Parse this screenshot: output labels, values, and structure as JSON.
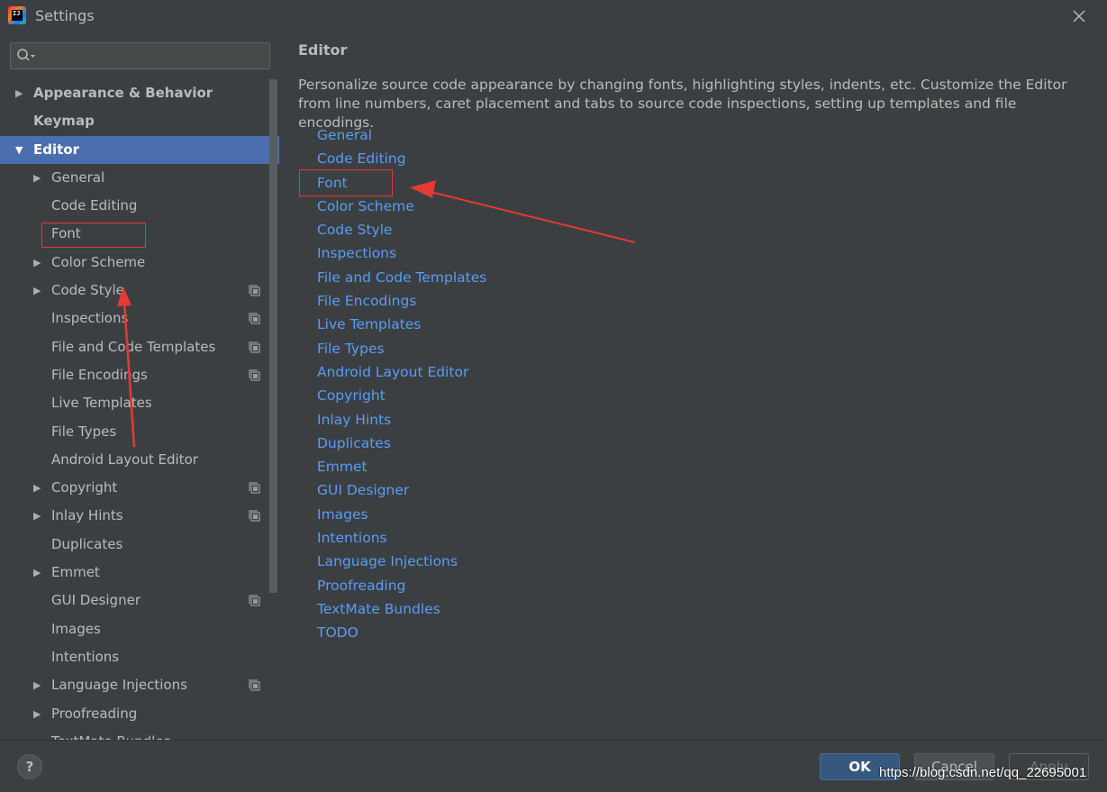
{
  "window": {
    "title": "Settings",
    "app_icon_text": "IJ"
  },
  "search": {
    "placeholder": "",
    "value": ""
  },
  "tree": [
    {
      "label": "Appearance & Behavior",
      "level": 0,
      "arrow": "▶",
      "selected": false,
      "project_icon": false
    },
    {
      "label": "Keymap",
      "level": 0,
      "arrow": "",
      "selected": false,
      "project_icon": false
    },
    {
      "label": "Editor",
      "level": 0,
      "arrow": "▼",
      "selected": true,
      "project_icon": false
    },
    {
      "label": "General",
      "level": 1,
      "arrow": "▶",
      "selected": false,
      "project_icon": false
    },
    {
      "label": "Code Editing",
      "level": 1,
      "arrow": "",
      "selected": false,
      "project_icon": false
    },
    {
      "label": "Font",
      "level": 1,
      "arrow": "",
      "selected": false,
      "project_icon": false
    },
    {
      "label": "Color Scheme",
      "level": 1,
      "arrow": "▶",
      "selected": false,
      "project_icon": false
    },
    {
      "label": "Code Style",
      "level": 1,
      "arrow": "▶",
      "selected": false,
      "project_icon": true
    },
    {
      "label": "Inspections",
      "level": 1,
      "arrow": "",
      "selected": false,
      "project_icon": true
    },
    {
      "label": "File and Code Templates",
      "level": 1,
      "arrow": "",
      "selected": false,
      "project_icon": true
    },
    {
      "label": "File Encodings",
      "level": 1,
      "arrow": "",
      "selected": false,
      "project_icon": true
    },
    {
      "label": "Live Templates",
      "level": 1,
      "arrow": "",
      "selected": false,
      "project_icon": false
    },
    {
      "label": "File Types",
      "level": 1,
      "arrow": "",
      "selected": false,
      "project_icon": false
    },
    {
      "label": "Android Layout Editor",
      "level": 1,
      "arrow": "",
      "selected": false,
      "project_icon": false
    },
    {
      "label": "Copyright",
      "level": 1,
      "arrow": "▶",
      "selected": false,
      "project_icon": true
    },
    {
      "label": "Inlay Hints",
      "level": 1,
      "arrow": "▶",
      "selected": false,
      "project_icon": true
    },
    {
      "label": "Duplicates",
      "level": 1,
      "arrow": "",
      "selected": false,
      "project_icon": false
    },
    {
      "label": "Emmet",
      "level": 1,
      "arrow": "▶",
      "selected": false,
      "project_icon": false
    },
    {
      "label": "GUI Designer",
      "level": 1,
      "arrow": "",
      "selected": false,
      "project_icon": true
    },
    {
      "label": "Images",
      "level": 1,
      "arrow": "",
      "selected": false,
      "project_icon": false
    },
    {
      "label": "Intentions",
      "level": 1,
      "arrow": "",
      "selected": false,
      "project_icon": false
    },
    {
      "label": "Language Injections",
      "level": 1,
      "arrow": "▶",
      "selected": false,
      "project_icon": true
    },
    {
      "label": "Proofreading",
      "level": 1,
      "arrow": "▶",
      "selected": false,
      "project_icon": false
    },
    {
      "label": "TextMate Bundles",
      "level": 1,
      "arrow": "",
      "selected": false,
      "project_icon": false
    }
  ],
  "main": {
    "title": "Editor",
    "description": "Personalize source code appearance by changing fonts, highlighting styles, indents, etc. Customize the Editor from line numbers, caret placement and tabs to source code inspections, setting up templates and file encodings.",
    "links": [
      "General",
      "Code Editing",
      "Font",
      "Color Scheme",
      "Code Style",
      "Inspections",
      "File and Code Templates",
      "File Encodings",
      "Live Templates",
      "File Types",
      "Android Layout Editor",
      "Copyright",
      "Inlay Hints",
      "Duplicates",
      "Emmet",
      "GUI Designer",
      "Images",
      "Intentions",
      "Language Injections",
      "Proofreading",
      "TextMate Bundles",
      "TODO"
    ]
  },
  "footer": {
    "help_label": "?",
    "ok_label": "OK",
    "cancel_label": "Cancel",
    "apply_label": "Apply"
  },
  "watermark": "https://blog.csdn.net/qq_22695001",
  "colors": {
    "background": "#3c3f41",
    "selection": "#4b6eaf",
    "link": "#589df6",
    "annotation": "#e53935"
  }
}
